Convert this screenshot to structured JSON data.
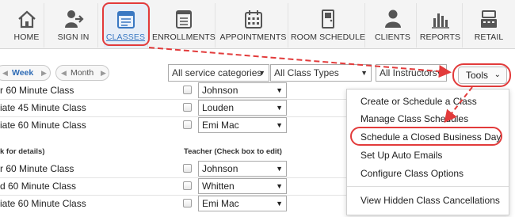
{
  "nav": {
    "items": [
      {
        "label": "HOME",
        "icon": "home-icon"
      },
      {
        "label": "SIGN IN",
        "icon": "sign-in-icon"
      },
      {
        "label": "CLASSES",
        "icon": "calendar-icon",
        "active": true
      },
      {
        "label": "ENROLLMENTS",
        "icon": "enrollments-icon"
      },
      {
        "label": "APPOINTMENTS",
        "icon": "appointments-icon"
      },
      {
        "label": "ROOM SCHEDULE",
        "icon": "door-icon"
      },
      {
        "label": "CLIENTS",
        "icon": "person-icon"
      },
      {
        "label": "REPORTS",
        "icon": "bar-chart-icon"
      },
      {
        "label": "RETAIL",
        "icon": "register-icon"
      }
    ]
  },
  "toolbar": {
    "week_label": "Week",
    "month_label": "Month",
    "filters": [
      "All service categories",
      "All Class Types",
      "All Instructors"
    ],
    "tools_label": "Tools"
  },
  "classes": {
    "group1": [
      {
        "name": "r 60 Minute Class",
        "teacher": "Johnson"
      },
      {
        "name": "iate 45 Minute Class",
        "teacher": "Louden"
      },
      {
        "name": "iate 60 Minute Class",
        "teacher": "Emi Mac"
      }
    ],
    "section_header_left": "k for details)",
    "section_header_teacher": "Teacher (Check box to edit)",
    "group2": [
      {
        "name": "r 60 Minute Class",
        "teacher": "Johnson"
      },
      {
        "name": "d 60 Minute Class",
        "teacher": "Whitten"
      },
      {
        "name": "iate 60 Minute Class",
        "teacher": "Emi Mac"
      }
    ]
  },
  "tools_menu": {
    "items": [
      "Create or Schedule a Class",
      "Manage Class Schedules",
      "Schedule a Closed Business Day",
      "Set Up Auto Emails",
      "Configure Class Options",
      "View Hidden Class Cancellations"
    ],
    "highlighted": "Schedule a Closed Business Day"
  },
  "colors": {
    "annotation_red": "#e23b3b",
    "link_blue": "#2e6bb5"
  }
}
